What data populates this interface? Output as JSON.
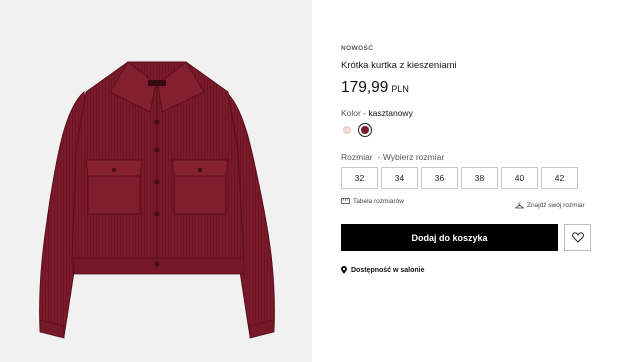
{
  "product": {
    "badge": "NOWOŚĆ",
    "title": "Krótka kurtka z kieszeniami",
    "price": "179,99",
    "currency": "PLN",
    "image_alt": "product-image-jacket"
  },
  "color": {
    "label": "Kolor",
    "separator": " - ",
    "value": "kasztanowy",
    "swatches": [
      {
        "name": "light-pink",
        "hex": "#f3dcd6"
      },
      {
        "name": "maroon",
        "hex": "#7a1a2c",
        "selected": true
      }
    ]
  },
  "size": {
    "label": "Rozmiar",
    "prompt": "- Wybierz rozmiar",
    "options": [
      "32",
      "34",
      "36",
      "38",
      "40",
      "42"
    ]
  },
  "links": {
    "size_guide": "Tabela rozmiarów",
    "find_size": "Znajdź swój rozmiar"
  },
  "actions": {
    "add_to_cart": "Dodaj do koszyka",
    "favorite_icon": "heart-icon"
  },
  "store": {
    "availability": "Dostępność w salonie",
    "icon": "location-pin-icon"
  },
  "colors": {
    "accent": "#000000",
    "jacket": "#7a1a2c"
  }
}
